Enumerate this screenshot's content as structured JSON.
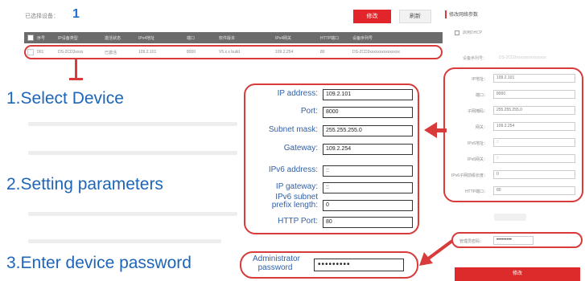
{
  "top_bar": {
    "count_label": "已选择设备：",
    "count_value": "1",
    "primary_button": "修改",
    "secondary_button": "刷新"
  },
  "table": {
    "headers": [
      "序号",
      "IP设备类型",
      "激活状态",
      "IPv4地址",
      "端口",
      "软件版本",
      "IPv4网关",
      "HTTP端口",
      "设备序列号"
    ],
    "row": [
      "001",
      "DS-2CD3xxxx",
      "已激活",
      "109.2.101",
      "8000",
      "V5.x.x build",
      "109.2.254",
      "80",
      "DS-2CD3xxxxxxxxxxxxxxx"
    ]
  },
  "steps": {
    "step1": "1.Select Device",
    "step2": "2.Setting parameters",
    "step3": "3.Enter device password"
  },
  "params": {
    "ip_label": "IP address:",
    "ip_value": "109.2.101",
    "port_label": "Port:",
    "port_value": "8000",
    "mask_label": "Subnet mask:",
    "mask_value": "255.255.255.0",
    "gateway_label": "Gateway:",
    "gateway_value": "109.2.254",
    "ipv6_label": "IPv6 address:",
    "ipv6_value": "::",
    "ipv6_gw_label": "IP gateway:",
    "ipv6_gw_value": "::",
    "ipv6_prefix_label": "IPv6 subnet prefix length:",
    "ipv6_prefix_value": "0",
    "http_label": "HTTP Port:",
    "http_value": "80"
  },
  "admin": {
    "label": "Administrator password",
    "value": "•••••••••"
  },
  "right_panel": {
    "title": "修改网络参数",
    "dhcp_label": "启用DHCP",
    "mac_label": "设备序列号：",
    "mac_value": "DS-2CD3xxxxxxxxxxxxxxx",
    "fields": [
      {
        "label": "IP地址：",
        "value": "109.2.101"
      },
      {
        "label": "端口：",
        "value": "8000"
      },
      {
        "label": "子网掩码：",
        "value": "255.255.255.0"
      },
      {
        "label": "网关：",
        "value": "109.2.254"
      },
      {
        "label": "IPv6地址：",
        "value": "::"
      },
      {
        "label": "IPv6网关：",
        "value": "::"
      },
      {
        "label": "IPv6子网前缀长度：",
        "value": "0"
      },
      {
        "label": "HTTP端口：",
        "value": "80"
      }
    ],
    "password_label": "管理员密码：",
    "password_value": "•••••••••",
    "confirm_button": "修改"
  },
  "colors": {
    "accent_red": "#d93a3a",
    "label_blue": "#2f5fa8",
    "step_blue": "#1d65b8"
  }
}
